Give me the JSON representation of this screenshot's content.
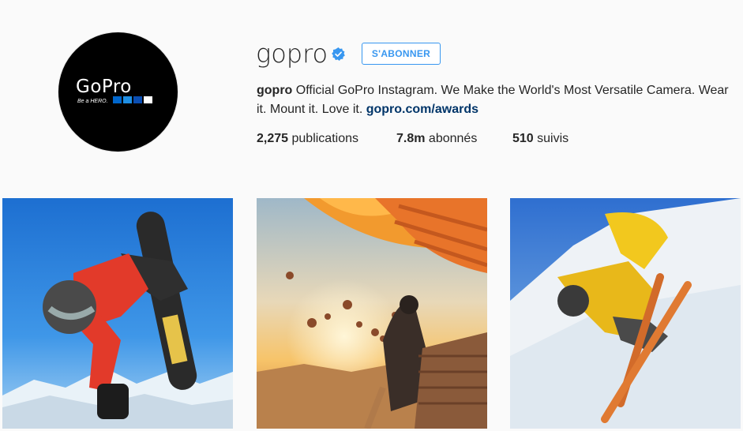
{
  "profile": {
    "username": "gopro",
    "follow_label": "S'ABONNER",
    "avatar": {
      "wordmark": "GoPro",
      "tagline": "Be a HERO.",
      "square_colors": [
        "#0066cc",
        "#1f8fe5",
        "#0b4fb3",
        "#ffffff"
      ]
    },
    "bio": {
      "name": "gopro",
      "text": "Official GoPro Instagram. We Make the World's Most Versatile Camera. Wear it. Mount it. Love it.",
      "link": "gopro.com/awards"
    },
    "stats": [
      {
        "value": "2,275",
        "label": "publications"
      },
      {
        "value": "7.8m",
        "label": "abonnés"
      },
      {
        "value": "510",
        "label": "suivis"
      }
    ]
  },
  "posts": [
    {
      "subject": "snowboarder-red-jacket"
    },
    {
      "subject": "hot-air-balloons"
    },
    {
      "subject": "skier-yellow-jacket"
    }
  ],
  "colors": {
    "accent": "#3897f0",
    "link": "#003569",
    "verified": "#3897f0"
  }
}
